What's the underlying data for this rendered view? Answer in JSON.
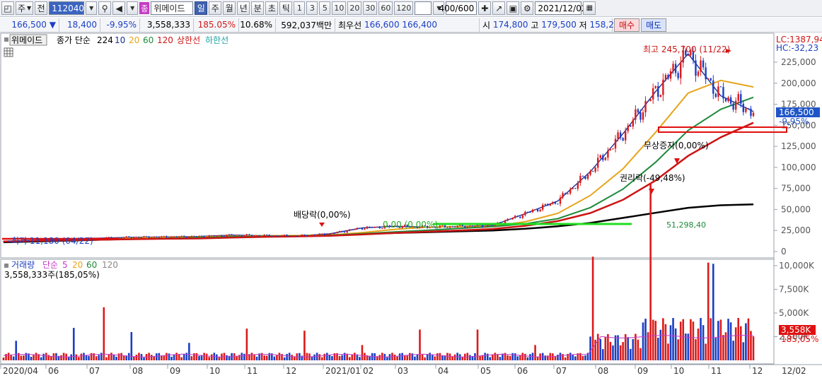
{
  "toolbar": {
    "period_select": "주",
    "all_label": "전",
    "stock_code": "112040",
    "jong_badge": "종",
    "stock_name": "위메이드",
    "periods": [
      "일",
      "주",
      "월",
      "년",
      "분",
      "초",
      "틱"
    ],
    "active_period": "일",
    "intervals": [
      "1",
      "3",
      "5",
      "10",
      "20",
      "30",
      "60",
      "120"
    ],
    "count": "400/600",
    "date": "2021/12/02"
  },
  "quote": {
    "price": "166,500",
    "change": "18,400",
    "change_pct": "-9.95%",
    "volume": "3,558,333",
    "vol_ratio": "185.05%",
    "turnover": "10.68%",
    "amount": "592,037백만",
    "best_label": "최우선",
    "best_ask": "166,600",
    "best_bid": "166,400",
    "open_label": "시",
    "open": "174,800",
    "high_label": "고",
    "high": "179,500",
    "low_label": "저",
    "low": "158,200",
    "buy_label": "매수",
    "sell_label": "매도"
  },
  "colors": {
    "up": "#dd1a1a",
    "down": "#1a3fc4",
    "ma5": "#1c2f8f",
    "ma20": "#e6a41a",
    "ma60": "#1e8a3a",
    "ma120": "#cc1414",
    "ma224": "#000000",
    "upper_limit": "#cc1414",
    "lower_limit": "#1aa3a3",
    "green_line": "#22dd22"
  },
  "chart_data": [
    {
      "type": "line",
      "title": "위메이드",
      "legend": {
        "label": "종가 단순",
        "periods": [
          "224",
          "10",
          "20",
          "60",
          "120"
        ],
        "upper_limit": "상한선",
        "lower_limit": "하한선"
      },
      "x_months": [
        "2020/04",
        "06",
        "07",
        "08",
        "09",
        "10",
        "11",
        "12",
        "2021/01",
        "02",
        "03",
        "04",
        "05",
        "06",
        "07",
        "08",
        "09",
        "10",
        "11",
        "12",
        "12/02"
      ],
      "y_ticks": [
        "225,000",
        "200,000",
        "175,000",
        "150,000",
        "125,000",
        "100,000",
        "75,000",
        "50,000",
        "25,000",
        "0"
      ],
      "ylim": [
        0,
        245700
      ],
      "lc_label": "LC:1387,94",
      "hc_label": "HC:-32,23",
      "series": [
        {
          "name": "종가",
          "values": [
            12000,
            13500,
            15000,
            16000,
            17000,
            17500,
            18000,
            19500,
            19000,
            18500,
            21000,
            28000,
            30000,
            29000,
            30000,
            31000,
            45000,
            60000,
            95000,
            140000,
            190000,
            235000,
            185000,
            166500
          ]
        },
        {
          "name": "224",
          "values": [
            11000,
            12000,
            13000,
            14000,
            15000,
            16000,
            17000,
            17500,
            18000,
            18500,
            19500,
            21000,
            22000,
            23000,
            24000,
            25000,
            27000,
            30000,
            34000,
            40000,
            46000,
            52000,
            55000,
            56000
          ]
        }
      ],
      "annotations": {
        "high_label": "최고 245,700 (11/22)",
        "low_label": "최저 11,180 (04/22)",
        "dividend_label": "배당락(0,00%)",
        "rights_label": "권리락(-49,48%)",
        "bonus_label": "무상증자(0,00%)",
        "green_label": "0,00 (0,00%)",
        "ma_label": "51,298,40",
        "price_tag": "166,500",
        "pct_tag": "-9,95%"
      }
    },
    {
      "type": "bar",
      "title": "거래량",
      "legend": {
        "label": "거래량",
        "simple": "단순",
        "periods": [
          "5",
          "20",
          "60",
          "120"
        ]
      },
      "current_label": "3,558,333주(185,05%)",
      "y_ticks": [
        "10,000K",
        "7,500K",
        "5,000K",
        "2,500K"
      ],
      "ylim": [
        0,
        10500000
      ],
      "volume_tag": "3,558K",
      "pct_tag": "185,05%"
    }
  ]
}
